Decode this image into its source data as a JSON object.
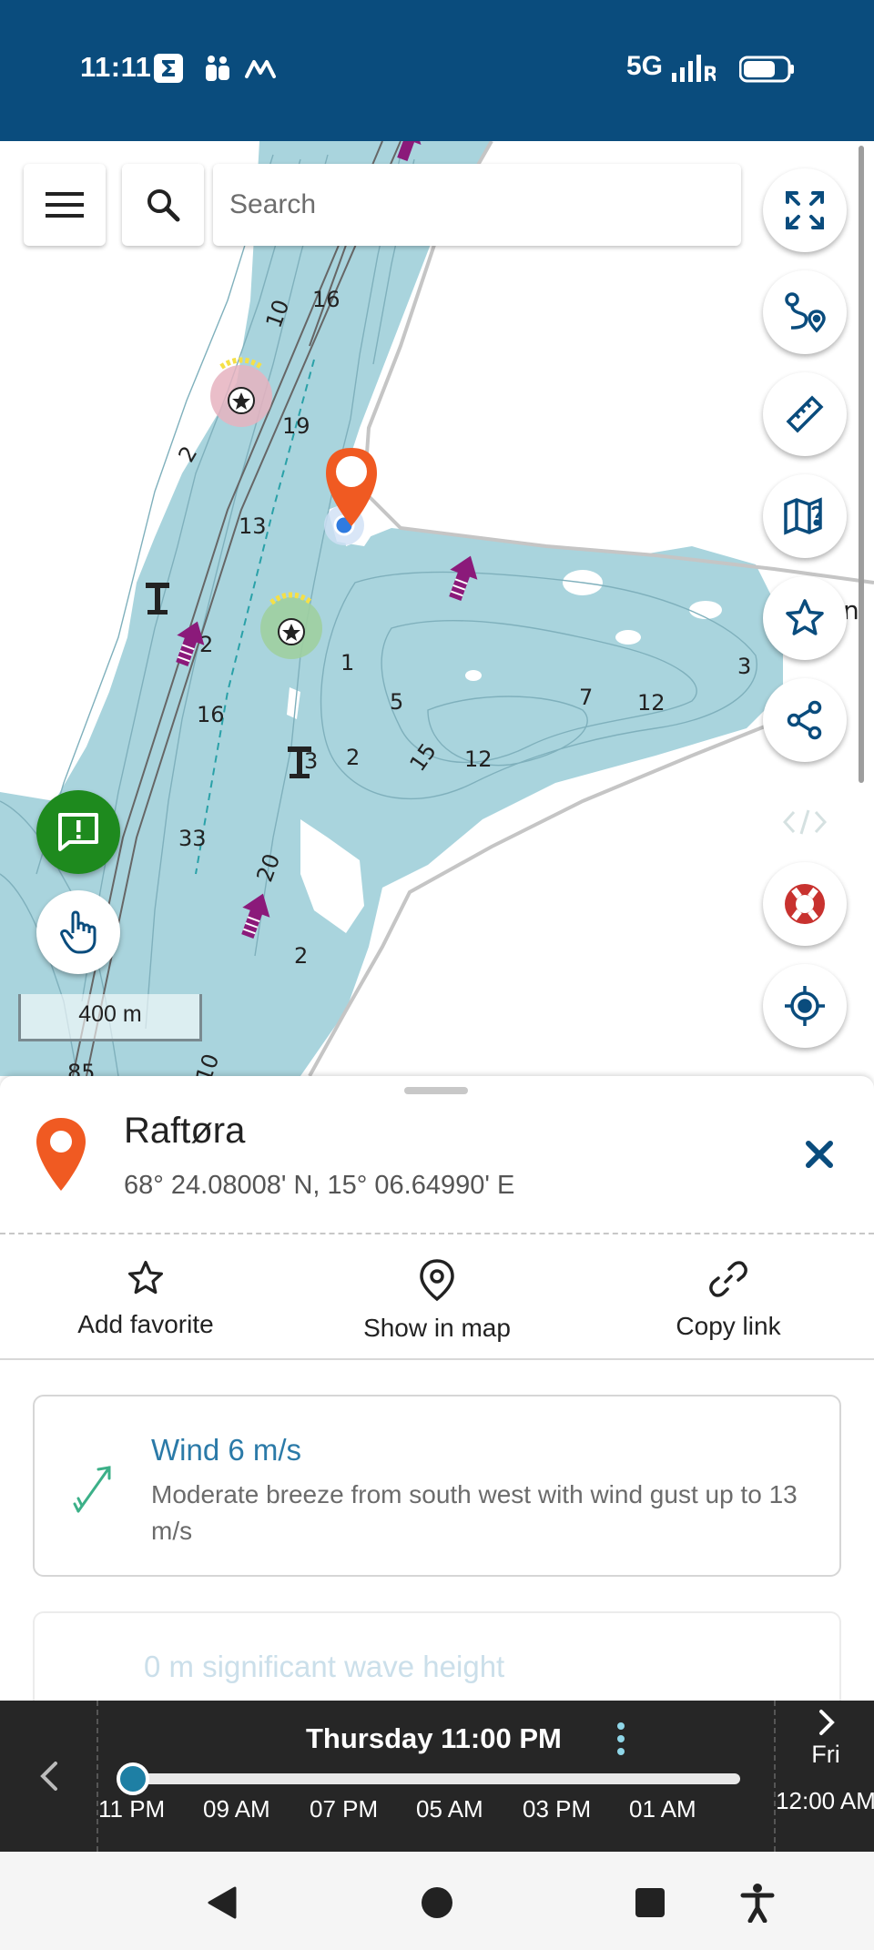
{
  "status_bar": {
    "time": "11:11",
    "network": "5G",
    "icons": [
      "sigma-app-icon",
      "teams-icon",
      "m-app-icon",
      "signal-icon",
      "roaming-r-icon",
      "battery-icon"
    ]
  },
  "colors": {
    "header": "#0a4c7d",
    "water": "#a9d4dd",
    "accent": "#0a4c7d",
    "pin": "#f05a22",
    "link_text": "#2b7aa8",
    "green_fab": "#1e8a1e"
  },
  "search": {
    "placeholder": "Search",
    "menu_icon": "hamburger-menu-icon",
    "search_icon": "search-icon"
  },
  "map": {
    "scale": "400 m",
    "right_buttons": [
      "fullscreen-icon",
      "route-icon",
      "ruler-icon",
      "map-info-icon",
      "favorite-star-icon",
      "share-icon",
      "embed-code-icon",
      "lifebuoy-icon",
      "locate-icon"
    ],
    "left_buttons": [
      "report-icon",
      "touch-hand-icon"
    ],
    "depths": [
      "16",
      "10",
      "19",
      "2",
      "13",
      "2",
      "16",
      "1",
      "5",
      "7",
      "12",
      "3",
      "3",
      "2",
      "15",
      "12",
      "33",
      "20",
      "2",
      "85",
      "10"
    ],
    "edge_letter": "n"
  },
  "place": {
    "name": "Raftøra",
    "coords": "68° 24.08008' N, 15° 06.64990' E"
  },
  "actions": {
    "add_favorite": "Add favorite",
    "show_in_map": "Show in map",
    "copy_link": "Copy link"
  },
  "wind": {
    "title": "Wind 6 m/s",
    "description": "Moderate breeze from south west with wind gust up to 13 m/s"
  },
  "wave": {
    "title": "0 m significant wave height"
  },
  "timeline": {
    "current": "Thursday 11:00 PM",
    "ticks": [
      "11 PM",
      "09 AM",
      "07 PM",
      "05 AM",
      "03 PM",
      "01 AM"
    ],
    "next_day": "Fri",
    "next_time": "12:00 AM",
    "position": 0
  },
  "nav": {
    "buttons": [
      "back-icon",
      "home-icon",
      "recents-icon",
      "accessibility-icon"
    ]
  }
}
